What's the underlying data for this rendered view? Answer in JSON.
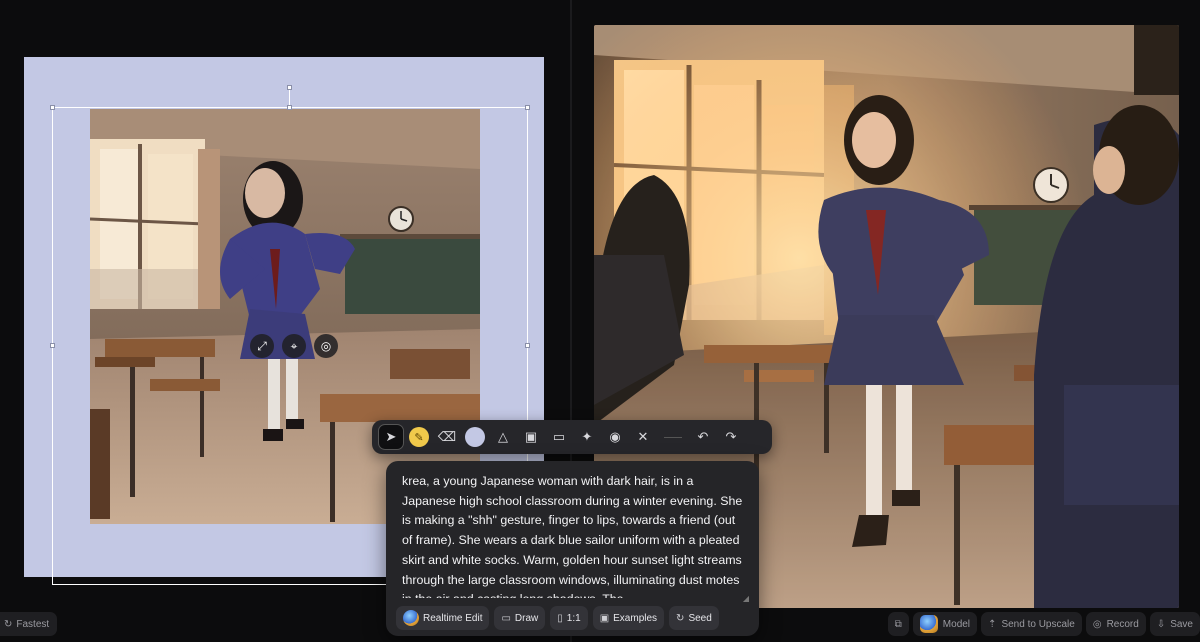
{
  "toolbar": {
    "tools": [
      {
        "name": "select-tool",
        "icon": "cursor-icon",
        "glyph": "➤"
      },
      {
        "name": "brush-tool",
        "icon": "pencil-icon",
        "glyph": "✎"
      },
      {
        "name": "eraser-tool",
        "icon": "eraser-icon",
        "glyph": "⌫"
      },
      {
        "name": "color-tool",
        "icon": "color-swatch-icon",
        "glyph": ""
      },
      {
        "name": "shapes-tool",
        "icon": "shapes-icon",
        "glyph": "△"
      },
      {
        "name": "image-tool",
        "icon": "image-icon",
        "glyph": "▣"
      },
      {
        "name": "folder-tool",
        "icon": "folder-icon",
        "glyph": "▭"
      },
      {
        "name": "ai-tool",
        "icon": "sparkle-icon",
        "glyph": "✦"
      },
      {
        "name": "camera-tool",
        "icon": "camera-icon",
        "glyph": "◉"
      },
      {
        "name": "delete-tool",
        "icon": "trash-icon",
        "glyph": "🗑"
      },
      {
        "name": "undo-tool",
        "icon": "undo-icon",
        "glyph": "↶"
      },
      {
        "name": "redo-tool",
        "icon": "redo-icon",
        "glyph": "↷"
      }
    ]
  },
  "prompt": {
    "text": "krea, a young Japanese woman with dark hair,  is in a Japanese high school classroom during a winter evening. She is making a \"shh\" gesture, finger to lips, towards a friend (out of frame). She wears a dark blue sailor uniform with a pleated skirt and white socks. Warm, golden hour sunset light streams through the large classroom windows, illuminating dust motes in the air and casting long shadows. The"
  },
  "prompt_chips": {
    "realtime_edit": "Realtime Edit",
    "draw": "Draw",
    "aspect": "1:1",
    "examples": "Examples",
    "seed": "Seed"
  },
  "bottom_left": {
    "speed": "Fastest"
  },
  "bottom_right": {
    "model": "Model",
    "upscale": "Send to Upscale",
    "record": "Record",
    "save": "Save"
  },
  "colors": {
    "canvas_background": "#c3c8e4",
    "brush_color": "#f0c94b",
    "app_background": "#0c0c0d",
    "panel": "#252528"
  }
}
